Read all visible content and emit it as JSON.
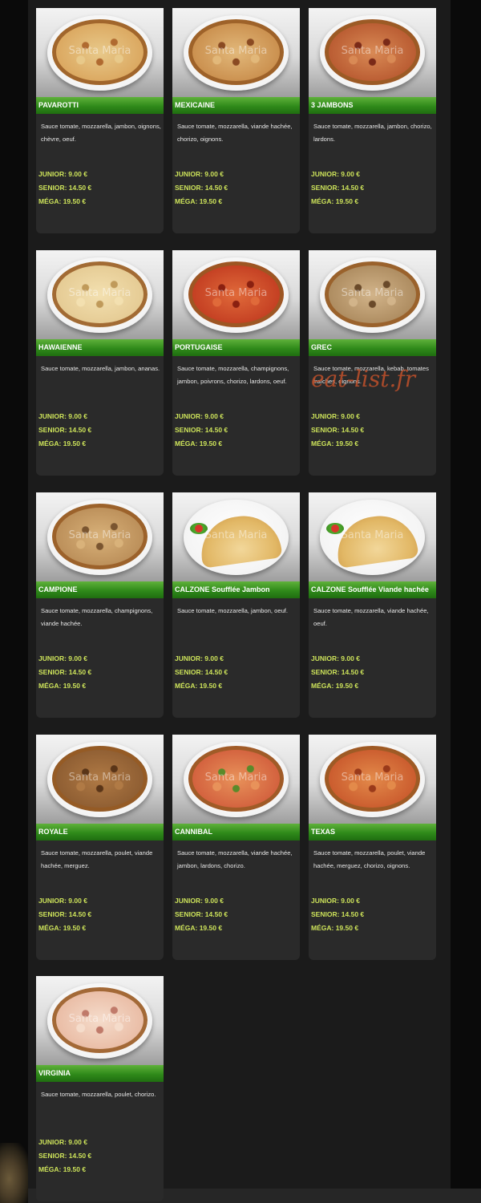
{
  "watermark": "Santa Maria",
  "overlay_watermark": "eat-list.fr",
  "price_labels": {
    "junior": "JUNIOR: 9.00 €",
    "senior": "SENIOR: 14.50 €",
    "mega": "MÉGA: 19.50 €"
  },
  "pizzas": [
    {
      "name": "PAVAROTTI",
      "desc": "Sauce tomate, mozzarella, jambon, oignons, chèvre, oeuf.",
      "image": "pizza-image"
    },
    {
      "name": "MEXICAINE",
      "desc": "Sauce tomate, mozzarella, viande hachée, chorizo, oignons.",
      "image": "pizza-image"
    },
    {
      "name": "3 JAMBONS",
      "desc": "Sauce tomate, mozzarella, jambon, chorizo, lardons.",
      "image": "pizza-image"
    },
    {
      "name": "HAWAIENNE",
      "desc": "Sauce tomate, mozzarella, jambon, ananas.",
      "image": "pizza-image"
    },
    {
      "name": "PORTUGAISE",
      "desc": "Sauce tomate, mozzarella, champignons, jambon, poivrons, chorizo, lardons, oeuf.",
      "image": "pizza-image"
    },
    {
      "name": "GREC",
      "desc": "Sauce tomate, mozzarella, kebab, tomates fraîches, oignons.",
      "image": "pizza-image"
    },
    {
      "name": "CAMPIONE",
      "desc": "Sauce tomate, mozzarella, champignons, viande hachée.",
      "image": "pizza-image"
    },
    {
      "name": "CALZONE Soufflée Jambon",
      "desc": "Sauce tomate, mozzarella, jambon, oeuf.",
      "image": "calzone-image"
    },
    {
      "name": "CALZONE Soufflée Viande hachée",
      "desc": "Sauce tomate, mozzarella, viande hachée, oeuf.",
      "image": "calzone-image"
    },
    {
      "name": "ROYALE",
      "desc": "Sauce tomate, mozzarella, poulet, viande hachée, merguez.",
      "image": "pizza-image"
    },
    {
      "name": "CANNIBAL",
      "desc": "Sauce tomate, mozzarella, viande hachée, jambon, lardons, chorizo.",
      "image": "pizza-image"
    },
    {
      "name": "TEXAS",
      "desc": "Sauce tomate, mozzarella, poulet, viande hachée, merguez, chorizo, oignons.",
      "image": "pizza-image"
    },
    {
      "name": "VIRGINIA",
      "desc": "Sauce tomate, mozzarella, poulet, chorizo.",
      "image": "pizza-image"
    }
  ],
  "colors": {
    "name_bar": "#2f8a1a",
    "price_text": "#cde35a",
    "card_bg": "#2a2a2a",
    "panel_bg": "#1b1b1b"
  }
}
